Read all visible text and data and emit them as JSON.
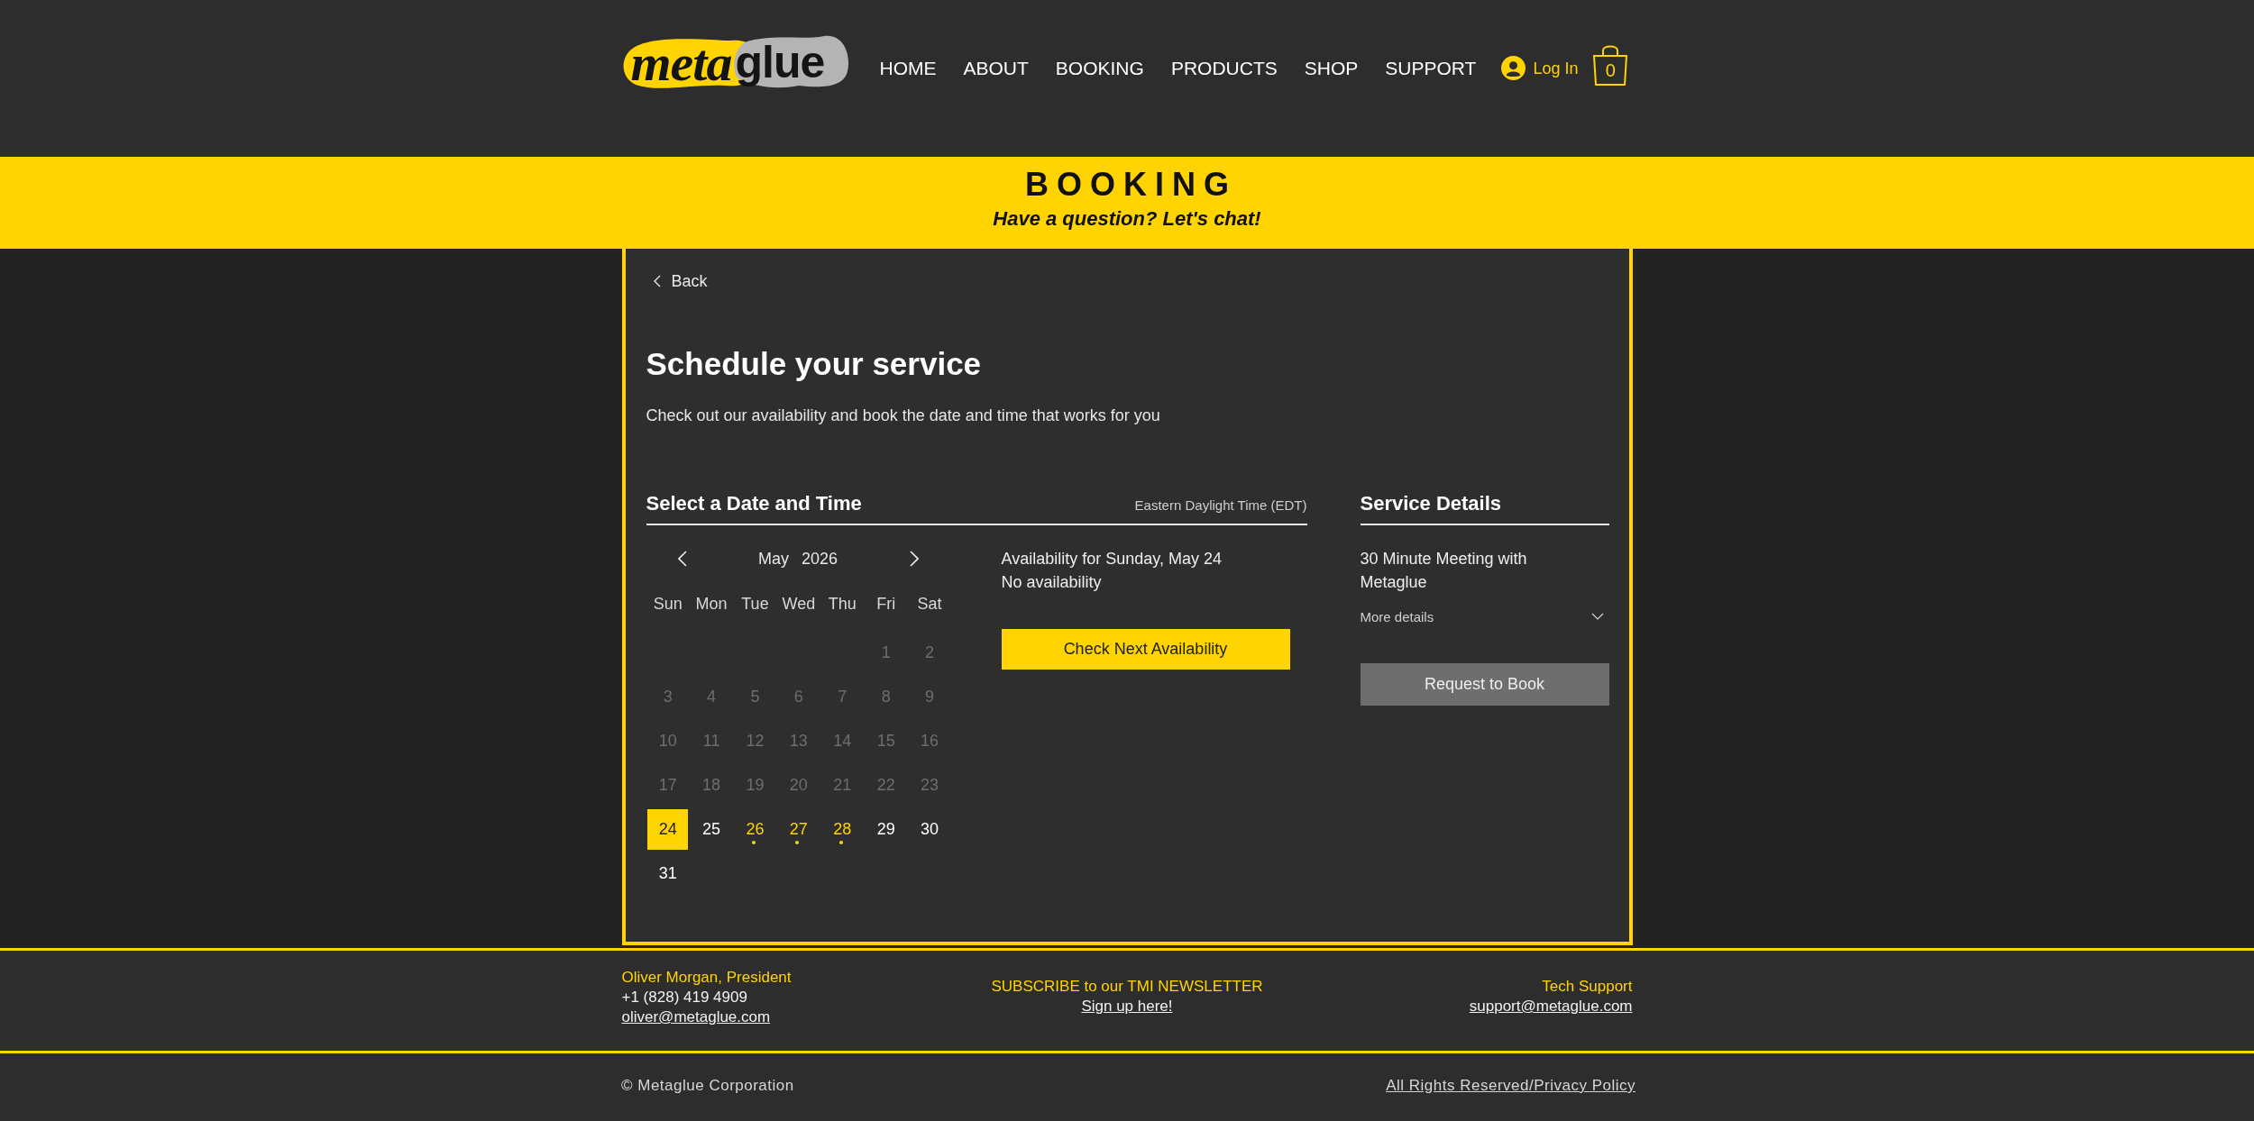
{
  "header": {
    "logo": {
      "parts": [
        "meta",
        "glue"
      ]
    },
    "nav": [
      {
        "label": "HOME"
      },
      {
        "label": "ABOUT"
      },
      {
        "label": "BOOKING"
      },
      {
        "label": "PRODUCTS"
      },
      {
        "label": "SHOP"
      },
      {
        "label": "SUPPORT"
      }
    ],
    "login": {
      "label": "Log In"
    },
    "cart": {
      "count": "0"
    }
  },
  "banner": {
    "title": "BOOKING",
    "subtitle": "Have a question? Let's chat!"
  },
  "booking": {
    "back": "Back",
    "title": "Schedule your service",
    "description": "Check out our availability and book the date and time that works for you",
    "date_time": {
      "heading": "Select a Date and Time",
      "timezone": "Eastern Daylight Time (EDT)"
    },
    "calendar": {
      "month": "May",
      "year": "2026",
      "weekdays": [
        "Sun",
        "Mon",
        "Tue",
        "Wed",
        "Thu",
        "Fri",
        "Sat"
      ],
      "weeks": [
        [
          {
            "label": "1",
            "disabled": true,
            "selected": false,
            "available": false
          },
          {
            "label": "2",
            "disabled": true,
            "selected": false,
            "available": false
          }
        ],
        [
          {
            "label": "3",
            "disabled": true,
            "selected": false,
            "available": false
          },
          {
            "label": "4",
            "disabled": true,
            "selected": false,
            "available": false
          },
          {
            "label": "5",
            "disabled": true,
            "selected": false,
            "available": false
          },
          {
            "label": "6",
            "disabled": true,
            "selected": false,
            "available": false
          },
          {
            "label": "7",
            "disabled": true,
            "selected": false,
            "available": false
          },
          {
            "label": "8",
            "disabled": true,
            "selected": false,
            "available": false
          },
          {
            "label": "9",
            "disabled": true,
            "selected": false,
            "available": false
          }
        ],
        [
          {
            "label": "10",
            "disabled": true,
            "selected": false,
            "available": false
          },
          {
            "label": "11",
            "disabled": true,
            "selected": false,
            "available": false
          },
          {
            "label": "12",
            "disabled": true,
            "selected": false,
            "available": false
          },
          {
            "label": "13",
            "disabled": true,
            "selected": false,
            "available": false
          },
          {
            "label": "14",
            "disabled": true,
            "selected": false,
            "available": false
          },
          {
            "label": "15",
            "disabled": true,
            "selected": false,
            "available": false
          },
          {
            "label": "16",
            "disabled": true,
            "selected": false,
            "available": false
          }
        ],
        [
          {
            "label": "17",
            "disabled": true,
            "selected": false,
            "available": false
          },
          {
            "label": "18",
            "disabled": true,
            "selected": false,
            "available": false
          },
          {
            "label": "19",
            "disabled": true,
            "selected": false,
            "available": false
          },
          {
            "label": "20",
            "disabled": true,
            "selected": false,
            "available": false
          },
          {
            "label": "21",
            "disabled": true,
            "selected": false,
            "available": false
          },
          {
            "label": "22",
            "disabled": true,
            "selected": false,
            "available": false
          },
          {
            "label": "23",
            "disabled": true,
            "selected": false,
            "available": false
          }
        ],
        [
          {
            "label": "24",
            "disabled": false,
            "selected": true,
            "available": false
          },
          {
            "label": "25",
            "disabled": false,
            "selected": false,
            "available": false
          },
          {
            "label": "26",
            "disabled": false,
            "selected": false,
            "available": true
          },
          {
            "label": "27",
            "disabled": false,
            "selected": false,
            "available": true
          },
          {
            "label": "28",
            "disabled": false,
            "selected": false,
            "available": true
          },
          {
            "label": "29",
            "disabled": false,
            "selected": false,
            "available": false
          },
          {
            "label": "30",
            "disabled": false,
            "selected": false,
            "available": false
          }
        ],
        [
          {
            "label": "31",
            "disabled": false,
            "selected": false,
            "available": false
          }
        ]
      ]
    },
    "availability": {
      "heading": "Availability for Sunday, May 24",
      "message": "No availability",
      "button": "Check Next Availability"
    },
    "service": {
      "heading": "Service Details",
      "name": "30 Minute Meeting with Metaglue",
      "more_details": {
        "label": "More details",
        "expanded": false
      },
      "request_button": {
        "label": "Request to Book",
        "disabled": true
      }
    }
  },
  "footer": {
    "contact": {
      "name": "Oliver Morgan, President",
      "phone": "+1 (828) 419 4909",
      "email": "oliver@metaglue.com"
    },
    "newsletter": {
      "title": "SUBSCRIBE to our TMI NEWSLETTER",
      "link": "Sign up here!"
    },
    "support": {
      "title": "Tech Support",
      "email": "support@metaglue.com"
    }
  },
  "bottom_bar": {
    "copyright": "© Metaglue Corporation",
    "legal_link": "All Rights Reserved/Privacy Policy"
  }
}
